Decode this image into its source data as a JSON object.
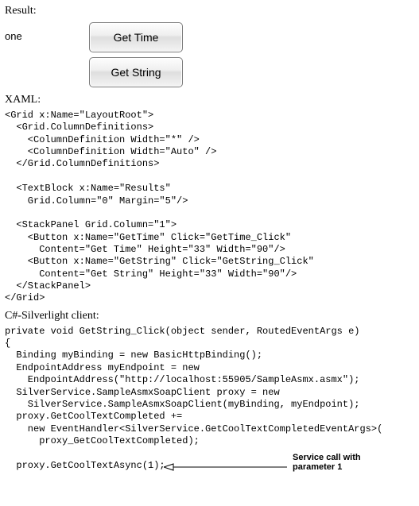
{
  "labels": {
    "result": "Result:",
    "xaml": "XAML:",
    "csharp": "C#-Silverlight client:"
  },
  "ui": {
    "result_text": "one",
    "button_get_time": "Get Time",
    "button_get_string": "Get String"
  },
  "xaml_code": "<Grid x:Name=\"LayoutRoot\">\n  <Grid.ColumnDefinitions>\n    <ColumnDefinition Width=\"*\" />\n    <ColumnDefinition Width=\"Auto\" />\n  </Grid.ColumnDefinitions>\n\n  <TextBlock x:Name=\"Results\"\n    Grid.Column=\"0\" Margin=\"5\"/>\n\n  <StackPanel Grid.Column=\"1\">\n    <Button x:Name=\"GetTime\" Click=\"GetTime_Click\"\n      Content=\"Get Time\" Height=\"33\" Width=\"90\"/>\n    <Button x:Name=\"GetString\" Click=\"GetString_Click\"\n      Content=\"Get String\" Height=\"33\" Width=\"90\"/>\n  </StackPanel>\n</Grid>",
  "cs_code": "private void GetString_Click(object sender, RoutedEventArgs e)\n{\n  Binding myBinding = new BasicHttpBinding();\n  EndpointAddress myEndpoint = new\n    EndpointAddress(\"http://localhost:55905/SampleAsmx.asmx\");\n  SilverService.SampleAsmxSoapClient proxy = new\n    SilverService.SampleAsmxSoapClient(myBinding, myEndpoint);\n  proxy.GetCoolTextCompleted +=\n    new EventHandler<SilverService.GetCoolTextCompletedEventArgs>(\n      proxy_GetCoolTextCompleted);\n\n  proxy.GetCoolTextAsync(1);",
  "annotation": {
    "note": "Service call with parameter 1"
  }
}
